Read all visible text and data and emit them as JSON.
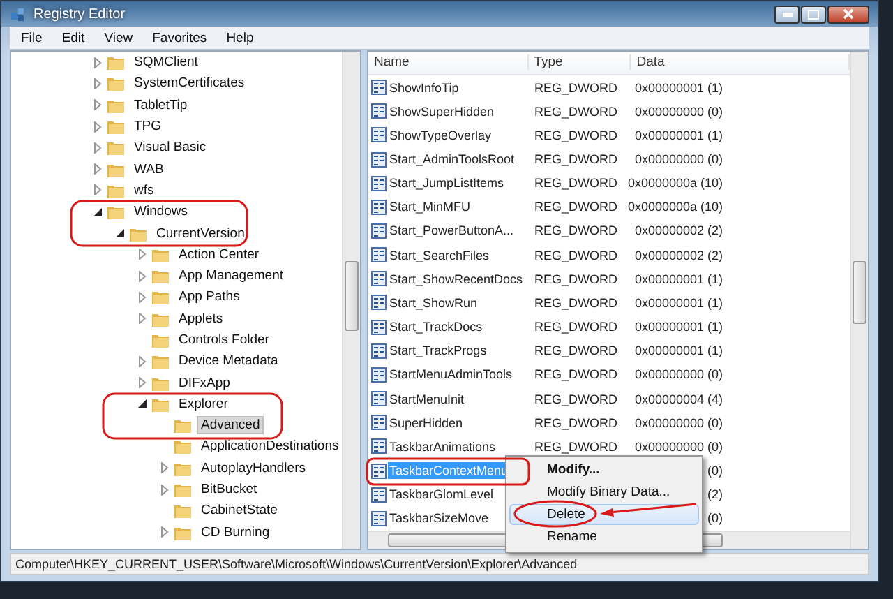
{
  "window": {
    "title": "Registry Editor"
  },
  "menu": [
    "File",
    "Edit",
    "View",
    "Favorites",
    "Help"
  ],
  "tree": [
    {
      "label": "SQMClient",
      "expandable": true,
      "expanded": false,
      "selected": false
    },
    {
      "label": "SystemCertificates",
      "expandable": true,
      "expanded": false,
      "selected": false
    },
    {
      "label": "TabletTip",
      "expandable": true,
      "expanded": false,
      "selected": false
    },
    {
      "label": "TPG",
      "expandable": true,
      "expanded": false,
      "selected": false
    },
    {
      "label": "Visual Basic",
      "expandable": true,
      "expanded": false,
      "selected": false
    },
    {
      "label": "WAB",
      "expandable": true,
      "expanded": false,
      "selected": false
    },
    {
      "label": "wfs",
      "expandable": true,
      "expanded": false,
      "selected": false
    },
    {
      "label": "Windows",
      "expandable": true,
      "expanded": true,
      "selected": false,
      "children": [
        {
          "label": "CurrentVersion",
          "expandable": true,
          "expanded": true,
          "selected": false,
          "children": [
            {
              "label": "Action Center",
              "expandable": true,
              "expanded": false,
              "selected": false
            },
            {
              "label": "App Management",
              "expandable": true,
              "expanded": false,
              "selected": false
            },
            {
              "label": "App Paths",
              "expandable": true,
              "expanded": false,
              "selected": false
            },
            {
              "label": "Applets",
              "expandable": true,
              "expanded": false,
              "selected": false
            },
            {
              "label": "Controls Folder",
              "expandable": false,
              "expanded": false,
              "selected": false
            },
            {
              "label": "Device Metadata",
              "expandable": true,
              "expanded": false,
              "selected": false
            },
            {
              "label": "DIFxApp",
              "expandable": true,
              "expanded": false,
              "selected": false
            },
            {
              "label": "Explorer",
              "expandable": true,
              "expanded": true,
              "selected": false,
              "children": [
                {
                  "label": "Advanced",
                  "expandable": false,
                  "expanded": false,
                  "selected": true
                },
                {
                  "label": "ApplicationDestinations",
                  "expandable": false,
                  "expanded": false,
                  "selected": false
                },
                {
                  "label": "AutoplayHandlers",
                  "expandable": true,
                  "expanded": false,
                  "selected": false
                },
                {
                  "label": "BitBucket",
                  "expandable": true,
                  "expanded": false,
                  "selected": false
                },
                {
                  "label": "CabinetState",
                  "expandable": false,
                  "expanded": false,
                  "selected": false
                },
                {
                  "label": "CD Burning",
                  "expandable": true,
                  "expanded": false,
                  "selected": false
                }
              ]
            }
          ]
        }
      ]
    }
  ],
  "values": {
    "columns": [
      "Name",
      "Type",
      "Data"
    ],
    "rows": [
      {
        "name": "ShowInfoTip",
        "type": "REG_DWORD",
        "data": "0x00000001 (1)",
        "selected": false
      },
      {
        "name": "ShowSuperHidden",
        "type": "REG_DWORD",
        "data": "0x00000000 (0)",
        "selected": false
      },
      {
        "name": "ShowTypeOverlay",
        "type": "REG_DWORD",
        "data": "0x00000001 (1)",
        "selected": false
      },
      {
        "name": "Start_AdminToolsRoot",
        "type": "REG_DWORD",
        "data": "0x00000000 (0)",
        "selected": false
      },
      {
        "name": "Start_JumpListItems",
        "type": "REG_DWORD",
        "data": "0x0000000a (10)",
        "selected": false
      },
      {
        "name": "Start_MinMFU",
        "type": "REG_DWORD",
        "data": "0x0000000a (10)",
        "selected": false
      },
      {
        "name": "Start_PowerButtonA...",
        "type": "REG_DWORD",
        "data": "0x00000002 (2)",
        "selected": false
      },
      {
        "name": "Start_SearchFiles",
        "type": "REG_DWORD",
        "data": "0x00000002 (2)",
        "selected": false
      },
      {
        "name": "Start_ShowRecentDocs",
        "type": "REG_DWORD",
        "data": "0x00000001 (1)",
        "selected": false
      },
      {
        "name": "Start_ShowRun",
        "type": "REG_DWORD",
        "data": "0x00000001 (1)",
        "selected": false
      },
      {
        "name": "Start_TrackDocs",
        "type": "REG_DWORD",
        "data": "0x00000001 (1)",
        "selected": false
      },
      {
        "name": "Start_TrackProgs",
        "type": "REG_DWORD",
        "data": "0x00000001 (1)",
        "selected": false
      },
      {
        "name": "StartMenuAdminTools",
        "type": "REG_DWORD",
        "data": "0x00000000 (0)",
        "selected": false
      },
      {
        "name": "StartMenuInit",
        "type": "REG_DWORD",
        "data": "0x00000004 (4)",
        "selected": false
      },
      {
        "name": "SuperHidden",
        "type": "REG_DWORD",
        "data": "0x00000000 (0)",
        "selected": false
      },
      {
        "name": "TaskbarAnimations",
        "type": "REG_DWORD",
        "data": "0x00000000 (0)",
        "selected": false
      },
      {
        "name": "TaskbarContextMenu",
        "type": "",
        "data": "(0)",
        "selected": true
      },
      {
        "name": "TaskbarGlomLevel",
        "type": "",
        "data": "(2)",
        "selected": false
      },
      {
        "name": "TaskbarSizeMove",
        "type": "",
        "data": "(0)",
        "selected": false
      }
    ]
  },
  "context_menu": [
    {
      "label": "Modify...",
      "bold": true,
      "highlighted": false
    },
    {
      "label": "Modify Binary Data...",
      "bold": false,
      "highlighted": false
    },
    {
      "label": "Delete",
      "bold": false,
      "highlighted": true
    },
    {
      "label": "Rename",
      "bold": false,
      "highlighted": false
    }
  ],
  "status_bar": "Computer\\HKEY_CURRENT_USER\\Software\\Microsoft\\Windows\\CurrentVersion\\Explorer\\Advanced"
}
